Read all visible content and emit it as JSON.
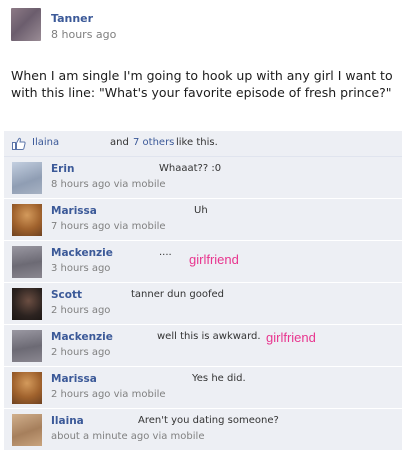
{
  "post": {
    "author": "Tanner",
    "time": "8 hours ago",
    "text": "When I am single I'm going to hook up with any girl I want to with this line: \"What's your favorite episode of fresh prince?\""
  },
  "likes": {
    "liker": "Ilaina",
    "and": "and",
    "others": "7 others",
    "suffix": "like this."
  },
  "comments": [
    {
      "name": "Erin",
      "text": "Whaaat?? :0",
      "meta": "8 hours ago via mobile",
      "overlay": "",
      "avatar_color": "#a8b4c8"
    },
    {
      "name": "Marissa",
      "text": "Uh",
      "meta": "7 hours ago via mobile",
      "overlay": "",
      "avatar_color": "#b5743c"
    },
    {
      "name": "Mackenzie",
      "text": "....",
      "meta": "3 hours ago",
      "overlay": "girlfriend",
      "avatar_color": "#8a8a93"
    },
    {
      "name": "Scott",
      "text": "tanner dun goofed",
      "meta": "2 hours ago",
      "overlay": "",
      "avatar_color": "#3a2d28"
    },
    {
      "name": "Mackenzie",
      "text": "well this is awkward.",
      "meta": "2 hours ago",
      "overlay": "girlfriend",
      "avatar_color": "#8a8a93"
    },
    {
      "name": "Marissa",
      "text": "Yes he did.",
      "meta": "2 hours ago via mobile",
      "overlay": "",
      "avatar_color": "#b5743c"
    },
    {
      "name": "Ilaina",
      "text": "Aren't you dating someone?",
      "meta": "about a minute ago via mobile",
      "overlay": "",
      "avatar_color": "#b79370"
    }
  ],
  "colors": {
    "link": "#3b5998",
    "comment_bg": "#edeff4",
    "overlay_text": "#e8358e"
  }
}
